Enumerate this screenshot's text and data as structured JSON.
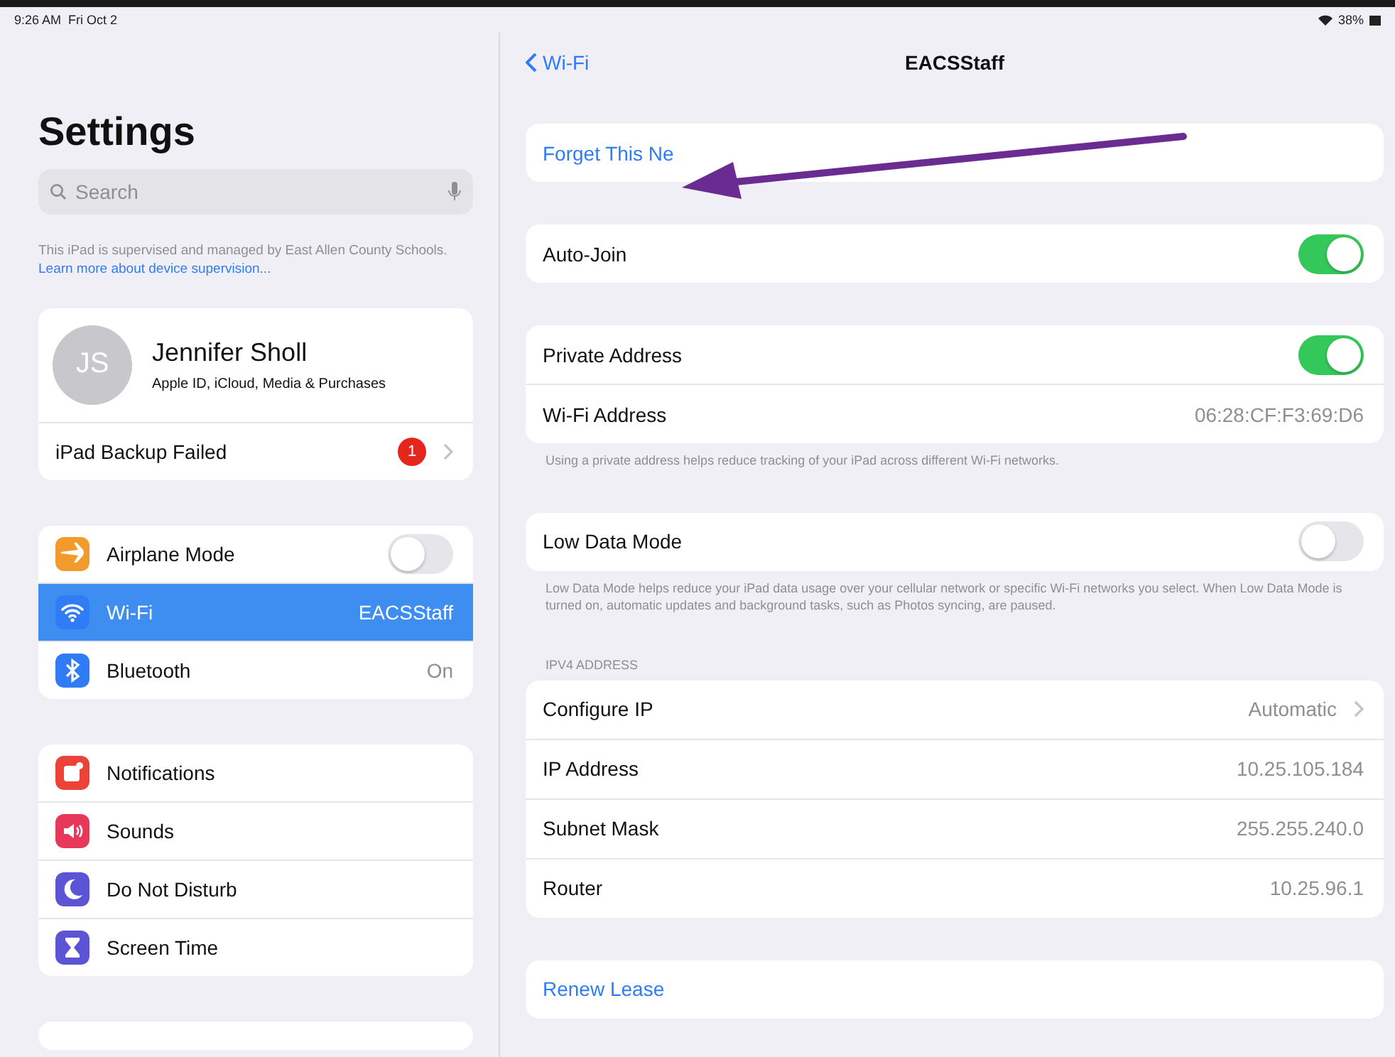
{
  "status_bar": {
    "time": "9:26 AM",
    "date": "Fri Oct 2",
    "battery": "38%"
  },
  "sidebar": {
    "title": "Settings",
    "search": {
      "placeholder": "Search"
    },
    "supervision_note": {
      "text": "This iPad is supervised and managed by East Allen County Schools. ",
      "link": "Learn more about device supervision..."
    },
    "account": {
      "initials": "JS",
      "name": "Jennifer Sholl",
      "subtitle": "Apple ID, iCloud, Media & Purchases",
      "alert": {
        "label": "iPad Backup Failed",
        "badge": "1"
      }
    },
    "groups": [
      {
        "items": [
          {
            "label": "Airplane Mode",
            "color": "#f29b2c",
            "kind": "toggle",
            "on": false,
            "selected": false
          },
          {
            "label": "Wi-Fi",
            "color": "#2f7cf6",
            "kind": "value",
            "value": "EACSStaff",
            "selected": true
          },
          {
            "label": "Bluetooth",
            "color": "#2f7cf6",
            "kind": "value",
            "value": "On",
            "selected": false
          }
        ]
      },
      {
        "items": [
          {
            "label": "Notifications",
            "color": "#ec4238",
            "kind": "plain",
            "selected": false
          },
          {
            "label": "Sounds",
            "color": "#e8385a",
            "kind": "plain",
            "selected": false
          },
          {
            "label": "Do Not Disturb",
            "color": "#5b55d6",
            "kind": "plain",
            "selected": false
          },
          {
            "label": "Screen Time",
            "color": "#5b55d6",
            "kind": "plain",
            "selected": false
          }
        ]
      }
    ]
  },
  "detail": {
    "back": "Wi-Fi",
    "title": "EACSStaff",
    "sections": [
      {
        "rows": [
          {
            "kind": "action",
            "label": "Forget This Ne"
          }
        ]
      },
      {
        "rows": [
          {
            "kind": "toggle",
            "label": "Auto-Join",
            "on": true
          }
        ]
      },
      {
        "rows": [
          {
            "kind": "toggle",
            "label": "Private Address",
            "on": true
          },
          {
            "kind": "value",
            "label": "Wi-Fi Address",
            "value": "06:28:CF:F3:69:D6"
          }
        ],
        "footer": "Using a private address helps reduce tracking of your iPad across different Wi-Fi networks."
      },
      {
        "rows": [
          {
            "kind": "toggle",
            "label": "Low Data Mode",
            "on": false
          }
        ],
        "footer": "Low Data Mode helps reduce your iPad data usage over your cellular network or specific Wi-Fi networks you select. When Low Data Mode is turned on, automatic updates and background tasks, such as Photos syncing, are paused."
      },
      {
        "header": "IPV4 ADDRESS",
        "rows": [
          {
            "kind": "link",
            "label": "Configure IP",
            "value": "Automatic"
          },
          {
            "kind": "value",
            "label": "IP Address",
            "value": "10.25.105.184"
          },
          {
            "kind": "value",
            "label": "Subnet Mask",
            "value": "255.255.240.0"
          },
          {
            "kind": "value",
            "label": "Router",
            "value": "10.25.96.1"
          }
        ]
      },
      {
        "rows": [
          {
            "kind": "action",
            "label": "Renew Lease"
          }
        ]
      }
    ]
  }
}
